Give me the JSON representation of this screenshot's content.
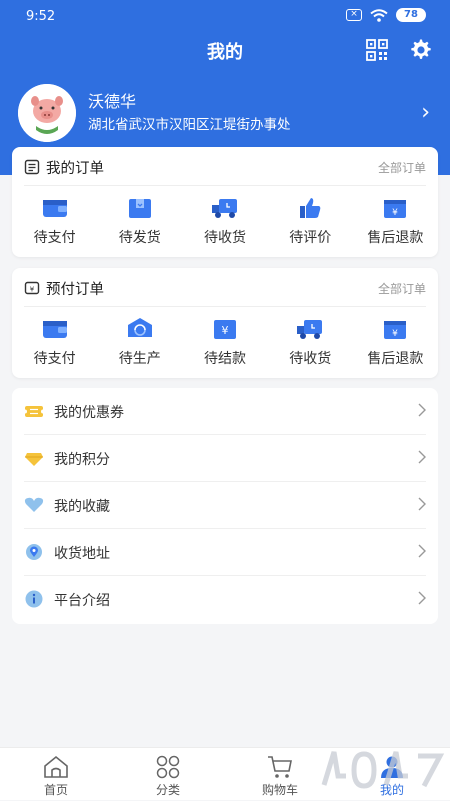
{
  "status": {
    "time": "9:52",
    "battery": "78",
    "sim_icon": "sim-x-icon",
    "wifi_icon": "wifi-icon"
  },
  "header": {
    "title": "我的",
    "qr_icon": "qrcode-icon",
    "settings_icon": "gear-icon"
  },
  "profile": {
    "name": "沃德华",
    "address": "湖北省武汉市汉阳区江堤街办事处"
  },
  "orders": {
    "title": "我的订单",
    "all_link": "全部订单",
    "items": [
      {
        "label": "待支付",
        "icon": "wallet-icon"
      },
      {
        "label": "待发货",
        "icon": "package-icon"
      },
      {
        "label": "待收货",
        "icon": "truck-icon"
      },
      {
        "label": "待评价",
        "icon": "thumb-up-icon"
      },
      {
        "label": "售后退款",
        "icon": "refund-icon"
      }
    ]
  },
  "prepaid": {
    "title": "预付订单",
    "all_link": "全部订单",
    "items": [
      {
        "label": "待支付",
        "icon": "wallet-icon"
      },
      {
        "label": "待生产",
        "icon": "production-icon"
      },
      {
        "label": "待结款",
        "icon": "settlement-icon"
      },
      {
        "label": "待收货",
        "icon": "truck-icon"
      },
      {
        "label": "售后退款",
        "icon": "refund-icon"
      }
    ]
  },
  "menu": [
    {
      "label": "我的优惠券",
      "icon": "coupon-icon"
    },
    {
      "label": "我的积分",
      "icon": "points-diamond-icon"
    },
    {
      "label": "我的收藏",
      "icon": "heart-icon"
    },
    {
      "label": "收货地址",
      "icon": "location-icon"
    },
    {
      "label": "平台介绍",
      "icon": "info-icon"
    }
  ],
  "tabs": [
    {
      "label": "首页",
      "icon": "home-icon"
    },
    {
      "label": "分类",
      "icon": "category-icon"
    },
    {
      "label": "购物车",
      "icon": "cart-icon"
    },
    {
      "label": "我的",
      "icon": "user-icon",
      "active": true
    }
  ],
  "colors": {
    "primary": "#2f6fe0",
    "background": "#f4f5f7"
  }
}
